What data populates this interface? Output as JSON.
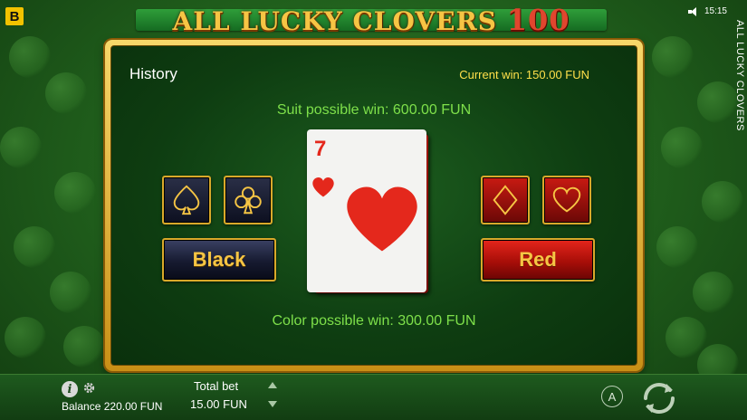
{
  "header": {
    "brand_logo": "B",
    "game_title": "ALL LUCKY CLOVERS",
    "game_title_number": "100",
    "time": "15:15",
    "side_label": "ALL LUCKY CLOVERS"
  },
  "gamble": {
    "history_label": "History",
    "current_win": "Current win: 150.00 FUN",
    "suit_possible_win": "Suit possible win: 600.00 FUN",
    "color_possible_win": "Color possible win: 300.00 FUN",
    "black_button": "Black",
    "red_button": "Red",
    "suit_buttons": [
      "spade-icon",
      "club-icon",
      "diamond-icon",
      "heart-icon"
    ],
    "card": {
      "rank": "7",
      "suit": "heart-icon",
      "color": "#e4281c"
    }
  },
  "footer": {
    "balance_label": "Balance",
    "balance_value": "220.00 FUN",
    "total_bet_label": "Total bet",
    "total_bet_value": "15.00 FUN",
    "auto_label": "A"
  },
  "colors": {
    "accent_gold": "#f6c544",
    "win_green": "#7ee04a",
    "current_win_yellow": "#ffe04a",
    "card_red": "#e4281c"
  }
}
